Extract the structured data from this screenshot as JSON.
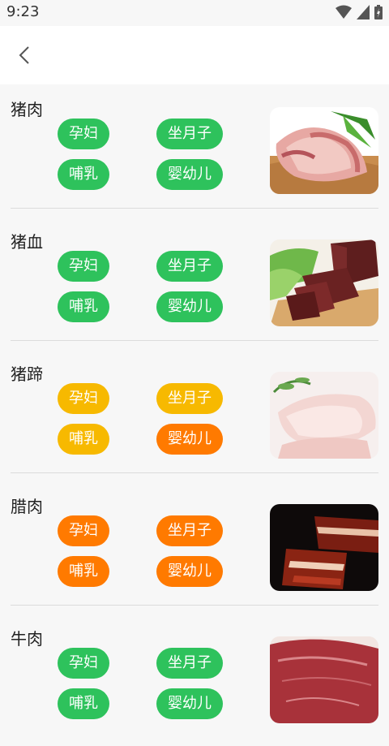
{
  "status_bar": {
    "time": "9:23"
  },
  "items": [
    {
      "name": "猪肉",
      "tags": [
        {
          "label": "孕妇",
          "level": "green"
        },
        {
          "label": "坐月子",
          "level": "green"
        },
        {
          "label": "哺乳",
          "level": "green"
        },
        {
          "label": "婴幼儿",
          "level": "green"
        }
      ],
      "image": "pork-image"
    },
    {
      "name": "猪血",
      "tags": [
        {
          "label": "孕妇",
          "level": "green"
        },
        {
          "label": "坐月子",
          "level": "green"
        },
        {
          "label": "哺乳",
          "level": "green"
        },
        {
          "label": "婴幼儿",
          "level": "green"
        }
      ],
      "image": "pig-blood-image"
    },
    {
      "name": "猪蹄",
      "tags": [
        {
          "label": "孕妇",
          "level": "yellow"
        },
        {
          "label": "坐月子",
          "level": "yellow"
        },
        {
          "label": "哺乳",
          "level": "yellow"
        },
        {
          "label": "婴幼儿",
          "level": "orange"
        }
      ],
      "image": "pig-trotter-image"
    },
    {
      "name": "腊肉",
      "tags": [
        {
          "label": "孕妇",
          "level": "orange"
        },
        {
          "label": "坐月子",
          "level": "orange"
        },
        {
          "label": "哺乳",
          "level": "orange"
        },
        {
          "label": "婴幼儿",
          "level": "orange"
        }
      ],
      "image": "cured-meat-image"
    },
    {
      "name": "牛肉",
      "tags": [
        {
          "label": "孕妇",
          "level": "green"
        },
        {
          "label": "坐月子",
          "level": "green"
        },
        {
          "label": "哺乳",
          "level": "green"
        },
        {
          "label": "婴幼儿",
          "level": "green"
        }
      ],
      "image": "beef-image"
    }
  ],
  "colors": {
    "green": "#2ec25c",
    "yellow": "#f7b900",
    "orange": "#ff7a00"
  }
}
